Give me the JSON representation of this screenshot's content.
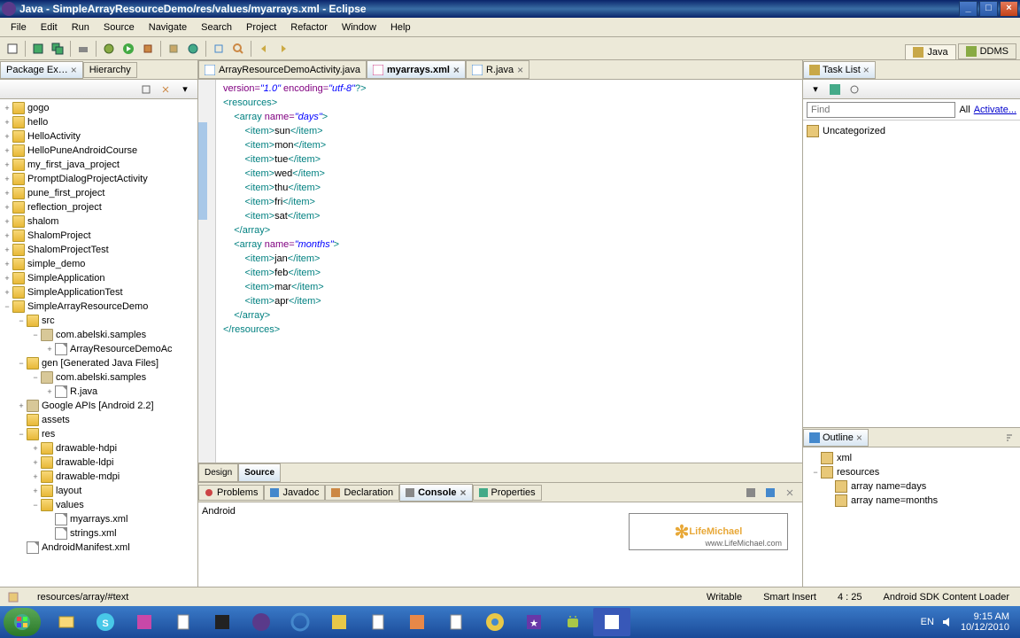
{
  "window": {
    "title": "Java - SimpleArrayResourceDemo/res/values/myarrays.xml - Eclipse"
  },
  "menu": {
    "items": [
      "File",
      "Edit",
      "Run",
      "Source",
      "Navigate",
      "Search",
      "Project",
      "Refactor",
      "Window",
      "Help"
    ]
  },
  "perspectives": {
    "java": "Java",
    "ddms": "DDMS"
  },
  "packageExplorer": {
    "title": "Package Ex…",
    "hierarchy": "Hierarchy",
    "items": [
      {
        "name": "gogo",
        "level": 0,
        "type": "project",
        "toggle": "+"
      },
      {
        "name": "hello",
        "level": 0,
        "type": "project",
        "toggle": "+"
      },
      {
        "name": "HelloActivity",
        "level": 0,
        "type": "project",
        "toggle": "+"
      },
      {
        "name": "HelloPuneAndroidCourse",
        "level": 0,
        "type": "project",
        "toggle": "+"
      },
      {
        "name": "my_first_java_project",
        "level": 0,
        "type": "project",
        "toggle": "+"
      },
      {
        "name": "PromptDialogProjectActivity",
        "level": 0,
        "type": "project",
        "toggle": "+"
      },
      {
        "name": "pune_first_project",
        "level": 0,
        "type": "project",
        "toggle": "+"
      },
      {
        "name": "reflection_project",
        "level": 0,
        "type": "project",
        "toggle": "+"
      },
      {
        "name": "shalom",
        "level": 0,
        "type": "project",
        "toggle": "+"
      },
      {
        "name": "ShalomProject",
        "level": 0,
        "type": "project",
        "toggle": "+"
      },
      {
        "name": "ShalomProjectTest",
        "level": 0,
        "type": "project",
        "toggle": "+"
      },
      {
        "name": "simple_demo",
        "level": 0,
        "type": "project",
        "toggle": "+"
      },
      {
        "name": "SimpleApplication",
        "level": 0,
        "type": "project",
        "toggle": "+"
      },
      {
        "name": "SimpleApplicationTest",
        "level": 0,
        "type": "project",
        "toggle": "+"
      },
      {
        "name": "SimpleArrayResourceDemo",
        "level": 0,
        "type": "project",
        "toggle": "−"
      },
      {
        "name": "src",
        "level": 1,
        "type": "folder",
        "toggle": "−"
      },
      {
        "name": "com.abelski.samples",
        "level": 2,
        "type": "package",
        "toggle": "−"
      },
      {
        "name": "ArrayResourceDemoAc",
        "level": 3,
        "type": "file",
        "toggle": "+"
      },
      {
        "name": "gen [Generated Java Files]",
        "level": 1,
        "type": "folder",
        "toggle": "−"
      },
      {
        "name": "com.abelski.samples",
        "level": 2,
        "type": "package",
        "toggle": "−"
      },
      {
        "name": "R.java",
        "level": 3,
        "type": "file",
        "toggle": "+"
      },
      {
        "name": "Google APIs [Android 2.2]",
        "level": 1,
        "type": "library",
        "toggle": "+"
      },
      {
        "name": "assets",
        "level": 1,
        "type": "folder",
        "toggle": ""
      },
      {
        "name": "res",
        "level": 1,
        "type": "folder",
        "toggle": "−"
      },
      {
        "name": "drawable-hdpi",
        "level": 2,
        "type": "folder",
        "toggle": "+"
      },
      {
        "name": "drawable-ldpi",
        "level": 2,
        "type": "folder",
        "toggle": "+"
      },
      {
        "name": "drawable-mdpi",
        "level": 2,
        "type": "folder",
        "toggle": "+"
      },
      {
        "name": "layout",
        "level": 2,
        "type": "folder",
        "toggle": "+"
      },
      {
        "name": "values",
        "level": 2,
        "type": "folder",
        "toggle": "−"
      },
      {
        "name": "myarrays.xml",
        "level": 3,
        "type": "file",
        "toggle": ""
      },
      {
        "name": "strings.xml",
        "level": 3,
        "type": "file",
        "toggle": ""
      },
      {
        "name": "AndroidManifest.xml",
        "level": 1,
        "type": "file",
        "toggle": ""
      }
    ]
  },
  "editor": {
    "tabs": [
      {
        "name": "ArrayResourceDemoActivity.java",
        "active": false
      },
      {
        "name": "myarrays.xml",
        "active": true
      },
      {
        "name": "R.java",
        "active": false
      }
    ],
    "bottomTabs": [
      "Design",
      "Source"
    ],
    "code": {
      "decl_open": "<?xml ",
      "attr_version": "version=",
      "val_version": "\"1.0\"",
      "attr_encoding": " encoding=",
      "val_encoding": "\"utf-8\"",
      "decl_close": "?>",
      "resources_open": "<resources>",
      "array_days_open": "    <array ",
      "attr_name": "name=",
      "val_days": "\"days\"",
      "tag_close": ">",
      "item_open": "        <item>",
      "item_close": "</item>",
      "days": [
        "sun",
        "mon",
        "tue",
        "wed",
        "thu",
        "fri",
        "sat"
      ],
      "array_close": "    </array>",
      "array_months_open": "    <array ",
      "val_months": "\"months\"",
      "months": [
        "jan",
        "feb",
        "mar",
        "apr"
      ],
      "resources_close": "</resources>"
    }
  },
  "bottomPanel": {
    "tabs": [
      "Problems",
      "Javadoc",
      "Declaration",
      "Console",
      "Properties"
    ],
    "activeTab": "Console",
    "content": "Android",
    "logo": "LifeMichael",
    "logoSub": "www.LifeMichael.com"
  },
  "taskList": {
    "title": "Task List",
    "find": "Find",
    "all": "All",
    "activate": "Activate...",
    "uncategorized": "Uncategorized"
  },
  "outline": {
    "title": "Outline",
    "items": [
      {
        "name": "xml",
        "level": 0
      },
      {
        "name": "resources",
        "level": 0,
        "toggle": "−"
      },
      {
        "name": "array name=days",
        "level": 1
      },
      {
        "name": "array name=months",
        "level": 1
      }
    ]
  },
  "statusbar": {
    "path": "resources/array/#text",
    "writable": "Writable",
    "insert": "Smart Insert",
    "pos": "4 : 25",
    "loader": "Android SDK Content Loader"
  },
  "tray": {
    "lang": "EN",
    "time": "9:15 AM",
    "date": "10/12/2010"
  }
}
